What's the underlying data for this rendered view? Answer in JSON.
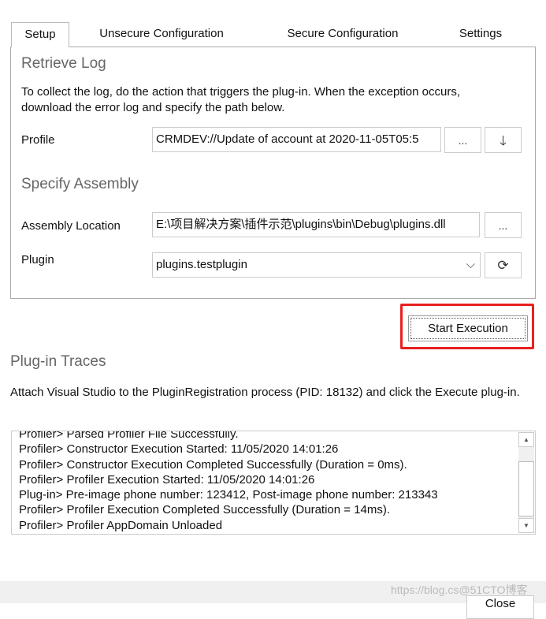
{
  "tabs": [
    {
      "label": "Setup",
      "active": true
    },
    {
      "label": "Unsecure Configuration"
    },
    {
      "label": "Secure Configuration"
    },
    {
      "label": "Settings"
    }
  ],
  "retrieve_log": {
    "title": "Retrieve Log",
    "instructions": "To collect the log, do the action that triggers the plug-in. When the exception occurs, download the error log and specify the path below.",
    "profile_label": "Profile",
    "profile_value": "CRMDEV://Update of account at 2020-11-05T05:5",
    "browse_label": "...",
    "download_icon": "arrow-down-icon"
  },
  "assembly": {
    "title": "Specify Assembly",
    "location_label": "Assembly Location",
    "location_value": "E:\\项目解决方案\\插件示范\\plugins\\bin\\Debug\\plugins.dll",
    "browse_label": "...",
    "plugin_label": "Plugin",
    "plugin_value": "plugins.testplugin",
    "refresh_icon": "refresh-icon"
  },
  "start_button": "Start Execution",
  "highlight_color": "#e8201e",
  "traces": {
    "title": "Plug-in Traces",
    "description": "Attach Visual Studio to the PluginRegistration process (PID: 18132) and click the Execute plug-in.",
    "lines": [
      "Profiler> Parsed Profiler File Successfully.",
      "Profiler> Constructor Execution Started: 11/05/2020 14:01:26",
      "Profiler> Constructor Execution Completed Successfully (Duration = 0ms).",
      "Profiler> Profiler Execution Started: 11/05/2020 14:01:26",
      "Plug-in> Pre-image phone number: 123412, Post-image phone number: 213343",
      "Profiler> Profiler Execution Completed Successfully (Duration = 14ms).",
      "Profiler> Profiler AppDomain Unloaded"
    ]
  },
  "close_button": "Close",
  "watermark": "https://blog.cs@51CTO博客"
}
